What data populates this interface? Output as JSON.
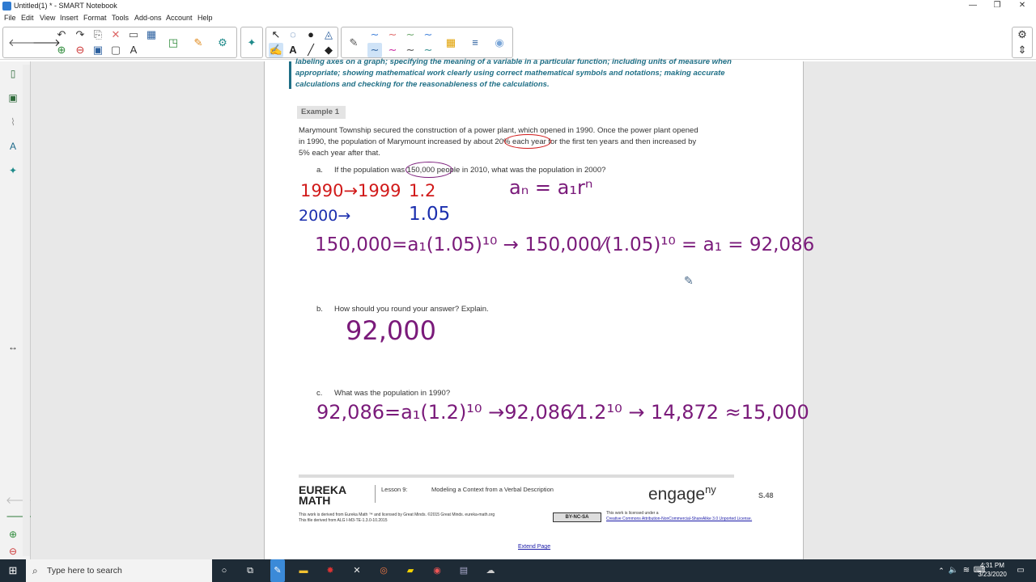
{
  "window": {
    "title": "Untitled(1) * - SMART Notebook",
    "minimize": "—",
    "maximize": "❐",
    "close": "✕"
  },
  "menu": [
    "File",
    "Edit",
    "View",
    "Insert",
    "Format",
    "Tools",
    "Add-ons",
    "Account",
    "Help"
  ],
  "document": {
    "standard_text": "labeling axes on a graph; specifying the meaning of a variable in a particular function; including units of measure when appropriate; showing mathematical work clearly using correct mathematical symbols and notations; making accurate calculations and checking for the reasonableness of the calculations.",
    "example_label": "Example 1",
    "problem_line1": "Marymount Township secured the construction of a power plant, which opened in 1990.  Once the power plant opened",
    "problem_line2": "in 1990, the population of Marymount increased by about 20% each year for the first ten years and then increased by",
    "problem_line3": "5% each year after that.",
    "q_a_letter": "a.",
    "q_a": "If the population was 150,000 people in 2010, what was the population in 2000?",
    "q_b_letter": "b.",
    "q_b": "How should you round your answer?  Explain.",
    "q_c_letter": "c.",
    "q_c": "What was the population in 1990?",
    "footer": {
      "brand_line1": "EUREKA",
      "brand_line2": "MATH",
      "lesson": "Lesson 9:",
      "lesson_title": "Modeling a Context from a Verbal Description",
      "engage": "engage",
      "engage_sup": "ny",
      "page_num": "S.48",
      "credit_line1": "This work is derived from Eureka Math ™ and licensed by Great Minds. ©2015 Great Minds. eureka-math.org",
      "credit_line2": "This file derived from ALG I-M3-TE-1.3.0-10.2015",
      "cc_badge": "BY-NC-SA",
      "license_line1": "This work is licensed under a",
      "license_link": "Creative Commons Attribution-NonCommercial-ShareAlike 3.0 Unported License."
    },
    "extend_page": "Extend Page"
  },
  "ink": {
    "red_years": "1990→1999",
    "red_rate": "1.2",
    "blue_year": "2000→",
    "blue_rate": "1.05",
    "formula": "aₙ = a₁rⁿ",
    "work_a": "150,000=a₁(1.05)¹⁰ → 150,000⁄(1.05)¹⁰ = a₁  = 92,086",
    "answer_b": "92,000",
    "work_c": "92,086=a₁(1.2)¹⁰ →92,086⁄1.2¹⁰ → 14,872 ≈15,000"
  },
  "taskbar": {
    "search_placeholder": "Type here to search",
    "time": "4:31 PM",
    "date": "3/23/2020"
  }
}
